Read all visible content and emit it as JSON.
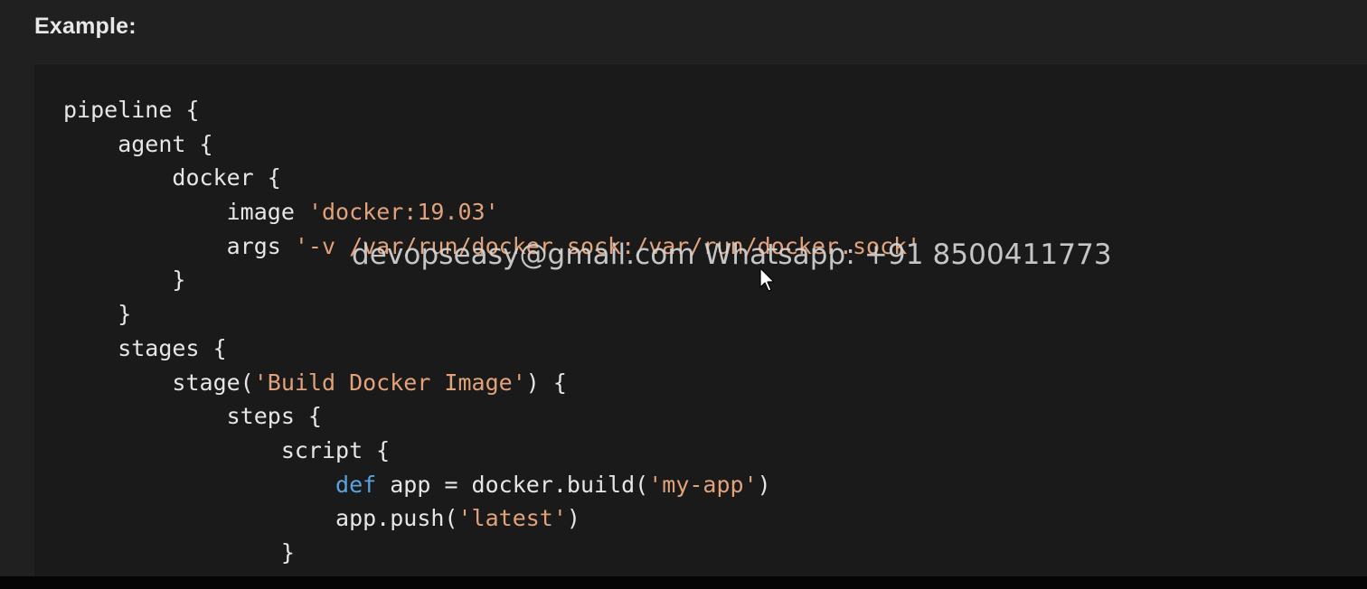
{
  "heading": "Example:",
  "watermark": "devopseasy@gmail.com Whatsapp: +91 8500411773",
  "code_lines": [
    [
      {
        "t": "pipeline {",
        "c": ""
      }
    ],
    [
      {
        "t": "    agent {",
        "c": ""
      }
    ],
    [
      {
        "t": "        docker {",
        "c": ""
      }
    ],
    [
      {
        "t": "            image ",
        "c": ""
      },
      {
        "t": "'docker:19.03'",
        "c": "str"
      }
    ],
    [
      {
        "t": "            args ",
        "c": ""
      },
      {
        "t": "'-v /var/run/docker.sock:/var/run/docker.sock'",
        "c": "str"
      }
    ],
    [
      {
        "t": "        }",
        "c": ""
      }
    ],
    [
      {
        "t": "    }",
        "c": ""
      }
    ],
    [
      {
        "t": "    stages {",
        "c": ""
      }
    ],
    [
      {
        "t": "        stage(",
        "c": ""
      },
      {
        "t": "'Build Docker Image'",
        "c": "str"
      },
      {
        "t": ") {",
        "c": ""
      }
    ],
    [
      {
        "t": "            steps {",
        "c": ""
      }
    ],
    [
      {
        "t": "                script {",
        "c": ""
      }
    ],
    [
      {
        "t": "                    ",
        "c": ""
      },
      {
        "t": "def",
        "c": "kw"
      },
      {
        "t": " app = docker.build(",
        "c": ""
      },
      {
        "t": "'my-app'",
        "c": "str"
      },
      {
        "t": ")",
        "c": ""
      }
    ],
    [
      {
        "t": "                    app.push(",
        "c": ""
      },
      {
        "t": "'latest'",
        "c": "str"
      },
      {
        "t": ")",
        "c": ""
      }
    ],
    [
      {
        "t": "                }",
        "c": ""
      }
    ]
  ],
  "colors": {
    "background": "#202020",
    "code_background": "#1a1a1a",
    "text": "#e6e6e6",
    "string": "#e2a27a",
    "keyword": "#5aa2e0"
  }
}
